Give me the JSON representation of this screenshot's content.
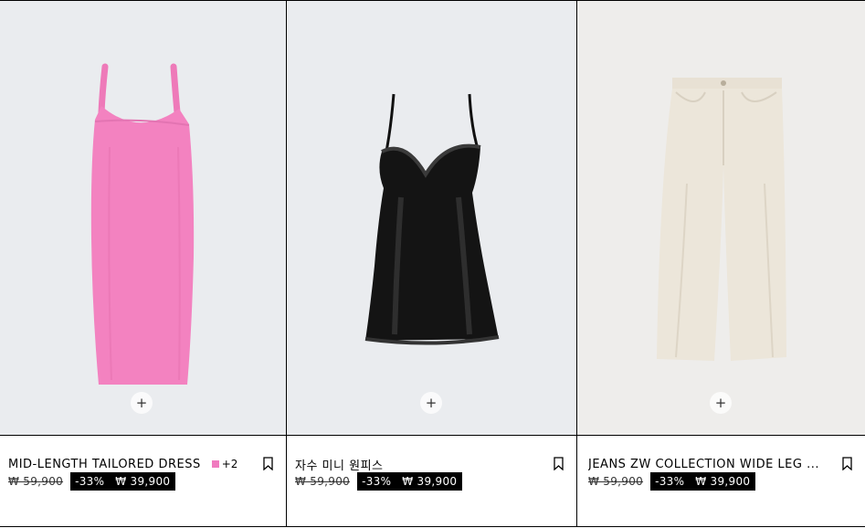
{
  "products": [
    {
      "name": "MID-LENGTH TAILORED DRESS",
      "extra_colors": "+2",
      "swatch_color": "#f07bbf",
      "old_price": "₩ 59,900",
      "discount": "-33%",
      "new_price": "₩ 39,900",
      "add_icon": "plus-icon",
      "bookmark_icon": "bookmark-icon"
    },
    {
      "name": "자수 미니 원피스",
      "old_price": "₩ 59,900",
      "discount": "-33%",
      "new_price": "₩ 39,900",
      "add_icon": "plus-icon",
      "bookmark_icon": "bookmark-icon"
    },
    {
      "name": "JEANS ZW COLLECTION WIDE LEG ...",
      "old_price": "₩ 59,900",
      "discount": "-33%",
      "new_price": "₩ 39,900",
      "add_icon": "plus-icon",
      "bookmark_icon": "bookmark-icon"
    }
  ],
  "colors": {
    "sale_background": "#000000",
    "sale_text": "#ffffff",
    "image_background": "#eaecef",
    "dress_pink": "#f07bbf"
  }
}
